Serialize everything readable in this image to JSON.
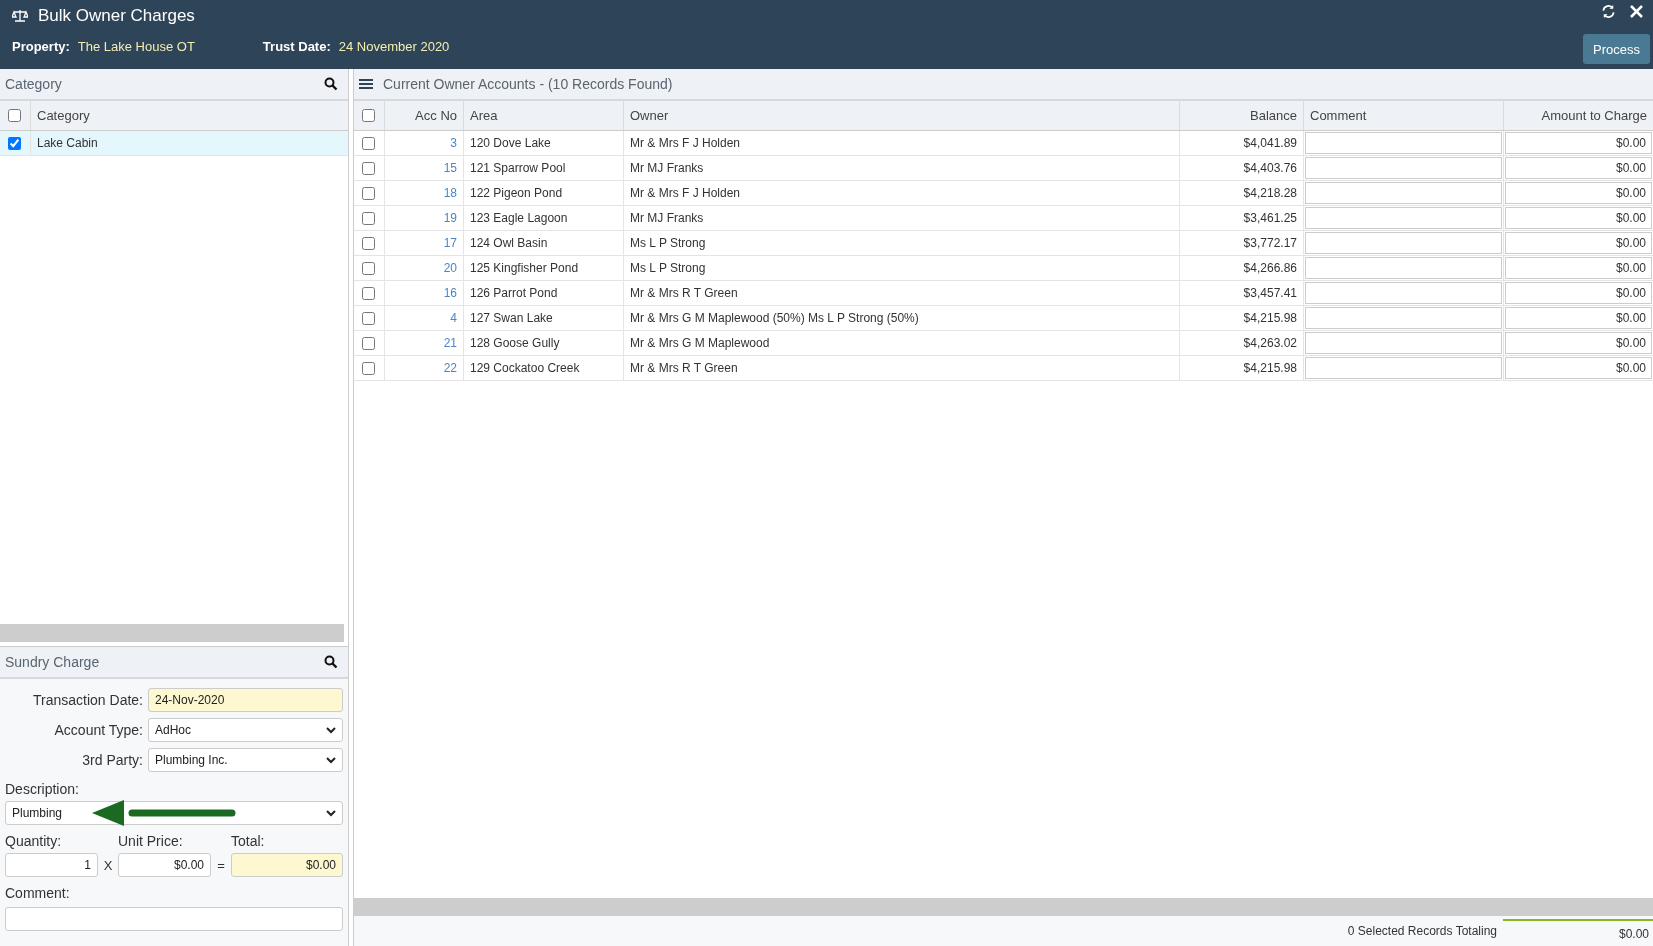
{
  "header": {
    "title": "Bulk Owner Charges",
    "property_label": "Property:",
    "property_value": "The Lake House OT",
    "trust_date_label": "Trust Date:",
    "trust_date_value": "24 November 2020",
    "process_button": "Process"
  },
  "category_panel": {
    "title": "Category",
    "header_checked": false,
    "column": "Category",
    "items": [
      {
        "label": "Lake Cabin",
        "checked": true,
        "selected": true
      }
    ]
  },
  "sundry_charge": {
    "title": "Sundry Charge",
    "transaction_date": {
      "label": "Transaction Date:",
      "value": "24-Nov-2020"
    },
    "account_type": {
      "label": "Account Type:",
      "value": "AdHoc"
    },
    "third_party": {
      "label": "3rd Party:",
      "value": "Plumbing Inc."
    },
    "description": {
      "label": "Description:",
      "value": "Plumbing"
    },
    "quantity": {
      "label": "Quantity:",
      "value": "1"
    },
    "times": "X",
    "unit_price": {
      "label": "Unit Price:",
      "value": "$0.00"
    },
    "equals": "=",
    "total": {
      "label": "Total:",
      "value": "$0.00"
    },
    "comment": {
      "label": "Comment:"
    }
  },
  "accounts": {
    "title": "Current Owner Accounts - (10 Records Found)",
    "header_checked": false,
    "columns": [
      "Acc No",
      "Area",
      "Owner",
      "Balance",
      "Comment",
      "Amount to Charge"
    ],
    "rows": [
      {
        "checked": false,
        "acc_no": "3",
        "area": "120 Dove Lake",
        "owner": "Mr & Mrs F J Holden",
        "balance": "$4,041.89",
        "amount": "$0.00"
      },
      {
        "checked": false,
        "acc_no": "15",
        "area": "121 Sparrow Pool",
        "owner": "Mr MJ Franks",
        "balance": "$4,403.76",
        "amount": "$0.00"
      },
      {
        "checked": false,
        "acc_no": "18",
        "area": "122 Pigeon Pond",
        "owner": "Mr & Mrs F J Holden",
        "balance": "$4,218.28",
        "amount": "$0.00"
      },
      {
        "checked": false,
        "acc_no": "19",
        "area": "123 Eagle Lagoon",
        "owner": "Mr MJ Franks",
        "balance": "$3,461.25",
        "amount": "$0.00"
      },
      {
        "checked": false,
        "acc_no": "17",
        "area": "124 Owl Basin",
        "owner": "Ms L P Strong",
        "balance": "$3,772.17",
        "amount": "$0.00"
      },
      {
        "checked": false,
        "acc_no": "20",
        "area": "125 Kingfisher Pond",
        "owner": "Ms L P Strong",
        "balance": "$4,266.86",
        "amount": "$0.00"
      },
      {
        "checked": false,
        "acc_no": "16",
        "area": "126 Parrot Pond",
        "owner": "Mr & Mrs R T Green",
        "balance": "$3,457.41",
        "amount": "$0.00"
      },
      {
        "checked": false,
        "acc_no": "4",
        "area": "127 Swan Lake",
        "owner": "Mr & Mrs G M Maplewood (50%) Ms L P Strong (50%)",
        "balance": "$4,215.98",
        "amount": "$0.00"
      },
      {
        "checked": false,
        "acc_no": "21",
        "area": "128 Goose Gully",
        "owner": "Mr & Mrs G M Maplewood",
        "balance": "$4,263.02",
        "amount": "$0.00"
      },
      {
        "checked": false,
        "acc_no": "22",
        "area": "129 Cockatoo Creek",
        "owner": "Mr & Mrs R T Green",
        "balance": "$4,215.98",
        "amount": "$0.00"
      }
    ],
    "footer": {
      "summary": "0 Selected Records Totaling",
      "total": "$0.00"
    }
  }
}
